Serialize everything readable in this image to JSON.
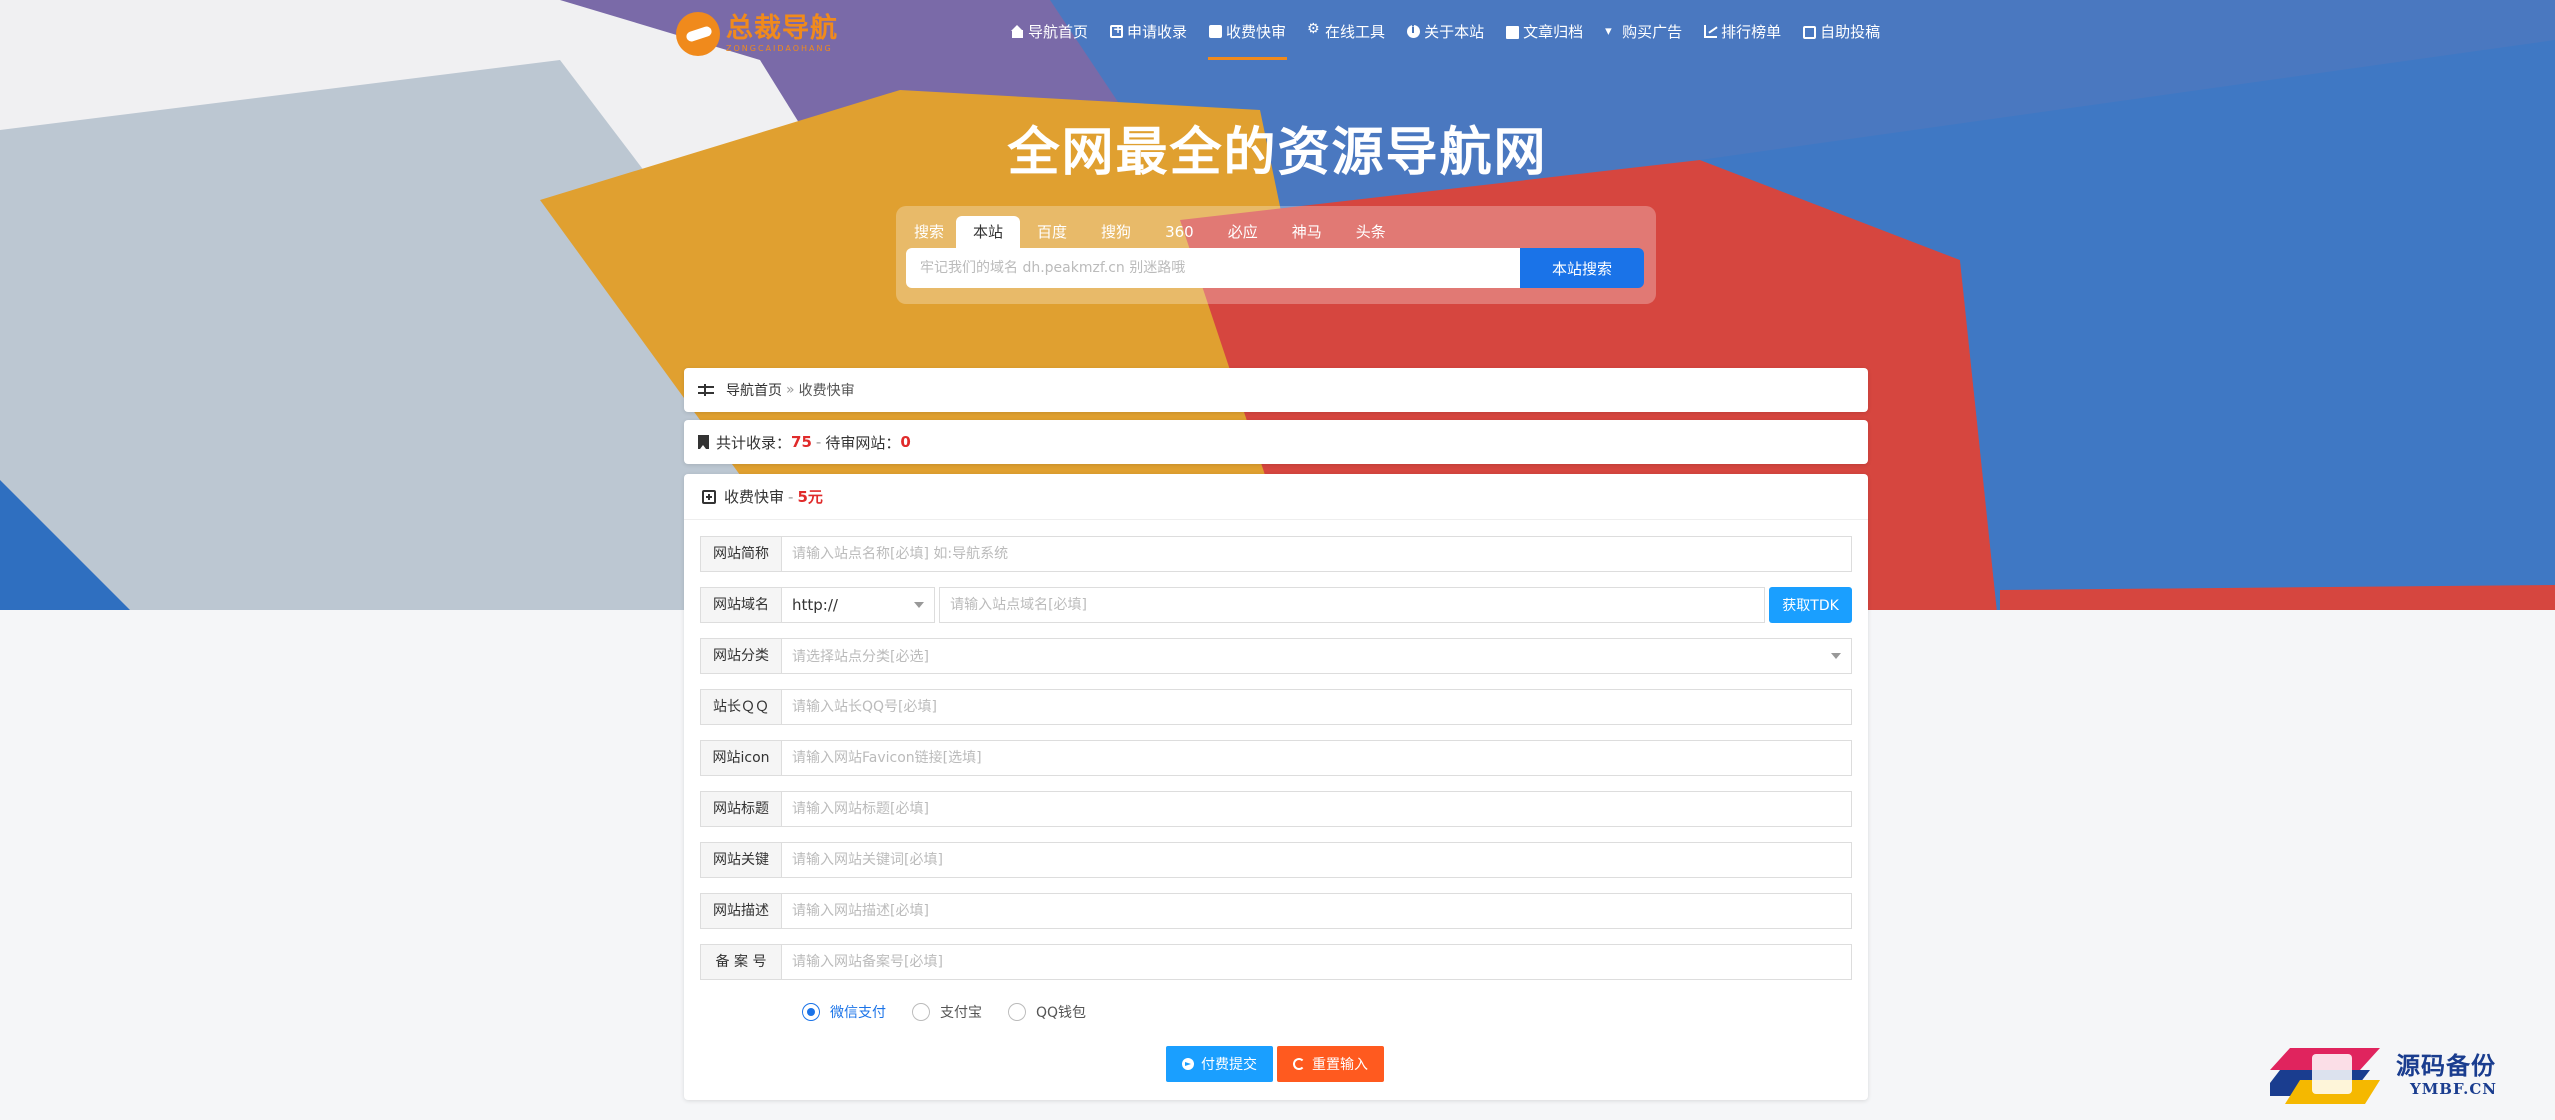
{
  "brand": {
    "logo_title": "总裁导航",
    "logo_sub": "ZONGCAIDAOHANG"
  },
  "nav": {
    "items": [
      {
        "label": "导航首页",
        "icon": "home-icon"
      },
      {
        "label": "申请收录",
        "icon": "plus-square-icon"
      },
      {
        "label": "收费快审",
        "icon": "document-icon",
        "active": true
      },
      {
        "label": "在线工具",
        "icon": "cogs-icon"
      },
      {
        "label": "关于本站",
        "icon": "info-icon"
      },
      {
        "label": "文章归档",
        "icon": "folder-icon"
      },
      {
        "label": "购买广告",
        "icon": "cart-icon"
      },
      {
        "label": "排行榜单",
        "icon": "line-chart-icon"
      },
      {
        "label": "自助投稿",
        "icon": "envelope-open-icon"
      }
    ]
  },
  "hero": {
    "title": "全网最全的资源导航网"
  },
  "search": {
    "label": "搜索",
    "tabs": [
      "本站",
      "百度",
      "搜狗",
      "360",
      "必应",
      "神马",
      "头条"
    ],
    "active_tab": "本站",
    "placeholder": "牢记我们的域名 dh.peakmzf.cn 别迷路哦",
    "button": "本站搜索"
  },
  "breadcrumb": {
    "home": "导航首页",
    "separator": "»",
    "current": "收费快审"
  },
  "stats": {
    "total_label": "共计收录：",
    "total_value": "75",
    "dash": "-",
    "pending_label": "待审网站：",
    "pending_value": "0"
  },
  "form": {
    "title": "收费快审",
    "dash": "-",
    "price": "5元",
    "fields": {
      "name": {
        "label": "网站简称",
        "placeholder": "请输入站点名称[必填] 如:导航系统"
      },
      "domain": {
        "label": "网站域名",
        "protocol": "http://",
        "placeholder": "请输入站点域名[必填]",
        "tdk_button": "获取TDK"
      },
      "category": {
        "label": "网站分类",
        "placeholder": "请选择站点分类[必选]"
      },
      "qq": {
        "label": "站长ＱＱ",
        "placeholder": "请输入站长QQ号[必填]"
      },
      "icon": {
        "label": "网站icon",
        "placeholder": "请输入网站Favicon链接[选填]"
      },
      "title": {
        "label": "网站标题",
        "placeholder": "请输入网站标题[必填]"
      },
      "keywords": {
        "label": "网站关键",
        "placeholder": "请输入网站关键词[必填]"
      },
      "description": {
        "label": "网站描述",
        "placeholder": "请输入网站描述[必填]"
      },
      "icp": {
        "label": "备 案 号",
        "placeholder": "请输入网站备案号[必填]"
      }
    },
    "payment": {
      "options": [
        "微信支付",
        "支付宝",
        "QQ钱包"
      ],
      "selected": "微信支付"
    },
    "submit": "付费提交",
    "reset": "重置输入"
  },
  "watermark": {
    "title": "源码备份",
    "sub": "YMBF.CN"
  },
  "colors": {
    "accent": "#1a73e8",
    "brand_orange": "#f08a1c",
    "submit": "#1a9fff",
    "reset": "#ff5a1f",
    "highlight_red": "#e02b2b"
  }
}
